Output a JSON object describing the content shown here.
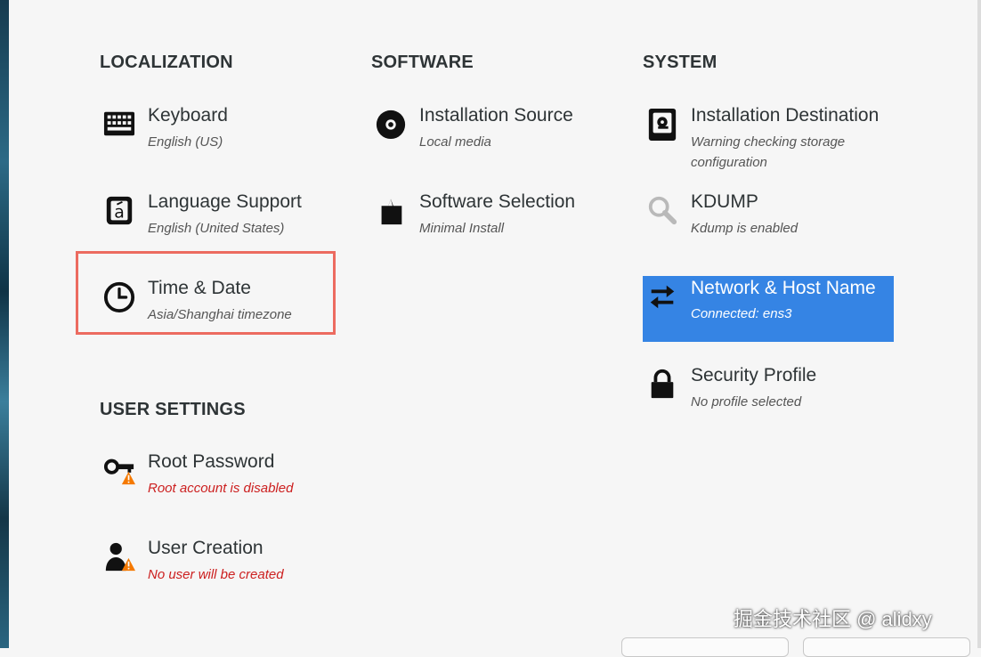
{
  "sections": {
    "localization": "LOCALIZATION",
    "software": "SOFTWARE",
    "system": "SYSTEM",
    "user_settings": "USER SETTINGS"
  },
  "spokes": {
    "keyboard": {
      "name": "Keyboard",
      "status": "English (US)",
      "icon": "keyboard-icon"
    },
    "language": {
      "name": "Language Support",
      "status": "English (United States)",
      "icon": "language-icon"
    },
    "time_date": {
      "name": "Time & Date",
      "status": "Asia/Shanghai timezone",
      "icon": "clock-icon"
    },
    "install_source": {
      "name": "Installation Source",
      "status": "Local media",
      "icon": "disc-icon"
    },
    "software_selection": {
      "name": "Software Selection",
      "status": "Minimal Install",
      "icon": "package-icon"
    },
    "install_destination": {
      "name": "Installation Destination",
      "status": "Warning checking storage\nconfiguration",
      "icon": "hard-drive-icon"
    },
    "kdump": {
      "name": "KDUMP",
      "status": "Kdump is enabled",
      "icon": "magnifier-icon"
    },
    "network": {
      "name": "Network & Host Name",
      "status": "Connected: ens3",
      "icon": "network-arrows-icon"
    },
    "security": {
      "name": "Security Profile",
      "status": "No profile selected",
      "icon": "lock-icon"
    },
    "root_password": {
      "name": "Root Password",
      "status": "Root account is disabled",
      "icon": "key-warning-icon"
    },
    "user_creation": {
      "name": "User Creation",
      "status": "No user will be created",
      "icon": "user-warning-icon"
    }
  },
  "colors": {
    "selected_bg": "#3584e4",
    "warning_text": "#cc1f1f",
    "highlight_border": "#ec6b60",
    "warning_badge": "#f57900"
  },
  "watermark": "掘金技术社区 @ alidxy"
}
